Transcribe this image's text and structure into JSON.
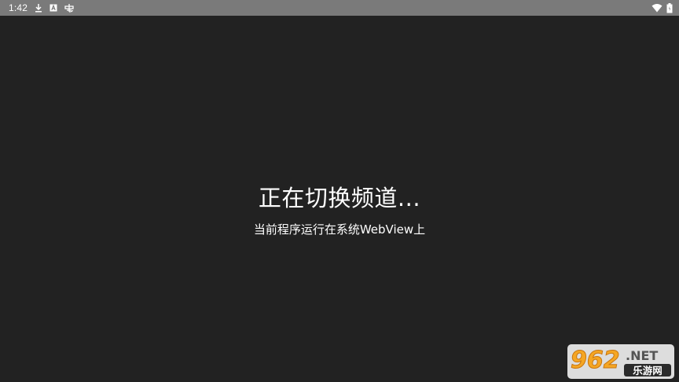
{
  "status_bar": {
    "time": "1:42",
    "icons": [
      "download-icon",
      "a-box-icon",
      "clipboard-icon"
    ],
    "right_icons": [
      "wifi-icon",
      "battery-icon"
    ],
    "background": "#7a7a7a"
  },
  "main": {
    "title": "正在切换频道...",
    "subtitle": "当前程序运行在系统WebView上",
    "background": "#222222"
  },
  "watermark": {
    "number": "962",
    "domain": ".NET",
    "site_name": "乐游网",
    "accent": "#f5a623"
  }
}
